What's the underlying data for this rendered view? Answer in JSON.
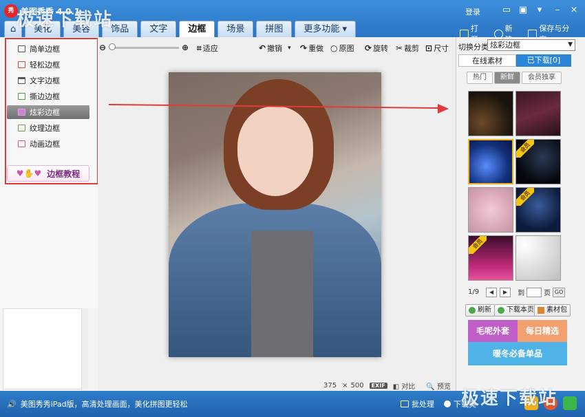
{
  "window": {
    "title": "美图秀秀 4.0.1",
    "login": "登录"
  },
  "tabs": [
    {
      "label": "美化"
    },
    {
      "label": "美容"
    },
    {
      "label": "饰品"
    },
    {
      "label": "文字"
    },
    {
      "label": "边框"
    },
    {
      "label": "场景"
    },
    {
      "label": "拼图"
    },
    {
      "label": "更多功能"
    }
  ],
  "top_actions": {
    "open": "打开",
    "new": "新建",
    "save_share": "保存与分享"
  },
  "left_menu": {
    "items": [
      {
        "label": "简单边框"
      },
      {
        "label": "轻松边框"
      },
      {
        "label": "文字边框"
      },
      {
        "label": "撕边边框"
      },
      {
        "label": "炫彩边框"
      },
      {
        "label": "纹理边框"
      },
      {
        "label": "动画边框"
      }
    ],
    "active_index": 4,
    "tutorial_button": "边框教程"
  },
  "toolbar": {
    "fit": "适应",
    "undo": "撤销",
    "redo": "重做",
    "original": "原图",
    "rotate": "旋转",
    "crop": "裁剪",
    "size": "尺寸"
  },
  "photo": {
    "width": "375",
    "height": "500",
    "exif_badge": "EXIF",
    "compare": "对比",
    "preview": "预览"
  },
  "right_panel": {
    "category_label": "切换分类",
    "category_value": "炫彩边框",
    "tab_online": "在线素材",
    "tab_downloaded": "已下载[0]",
    "subtabs": [
      {
        "label": "热门"
      },
      {
        "label": "新鲜"
      },
      {
        "label": "会员独享"
      }
    ],
    "thumb_badge": "会员",
    "pager": {
      "page": "1/9",
      "goto_prefix": "到",
      "goto_suffix": "页",
      "go": "GO"
    },
    "buttons": {
      "refresh": "刷新",
      "download_page": "下载本页",
      "material_pack": "素材包"
    },
    "ads": [
      {
        "label": "毛呢外套"
      },
      {
        "label": "每日精选"
      },
      {
        "label": "暖冬必备单品"
      }
    ],
    "colors": {
      "tab_downloaded_bg": "#2c86d8",
      "annotation_red": "#e23a3a"
    }
  },
  "statusbar": {
    "message": "美图秀秀iPad版，高清处理画面，美化拼图更轻松",
    "batch": "批处理",
    "download": "下载美"
  },
  "watermarks": {
    "top": "极速下载站",
    "bottom": "极速下载站"
  }
}
